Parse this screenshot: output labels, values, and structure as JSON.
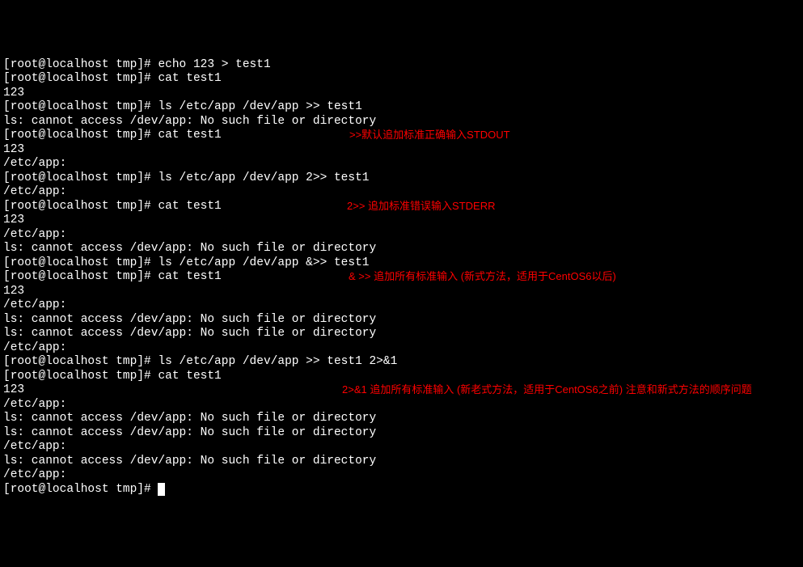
{
  "prompt": "[root@localhost tmp]#",
  "lines": [
    {
      "type": "cmd",
      "text": "echo 123 > test1"
    },
    {
      "type": "cmd",
      "text": "cat test1"
    },
    {
      "type": "out",
      "text": "123"
    },
    {
      "type": "cmd",
      "text": "ls /etc/app /dev/app >> test1"
    },
    {
      "type": "out",
      "text": "ls: cannot access /dev/app: No such file or directory"
    },
    {
      "type": "cmd",
      "text": "cat test1",
      "anno": ">>默认追加标准正确输入STDOUT",
      "annoLeft": 428
    },
    {
      "type": "out",
      "text": "123"
    },
    {
      "type": "out",
      "text": "/etc/app:"
    },
    {
      "type": "cmd",
      "text": "ls /etc/app /dev/app 2>> test1"
    },
    {
      "type": "out",
      "text": "/etc/app:"
    },
    {
      "type": "cmd",
      "text": "cat test1",
      "anno": "2>> 追加标准错误输入STDERR",
      "annoLeft": 425
    },
    {
      "type": "out",
      "text": "123"
    },
    {
      "type": "out",
      "text": "/etc/app:"
    },
    {
      "type": "out",
      "text": "ls: cannot access /dev/app: No such file or directory"
    },
    {
      "type": "cmd",
      "text": "ls /etc/app /dev/app &>> test1"
    },
    {
      "type": "cmd",
      "text": "cat test1",
      "anno": "& >> 追加所有标准输入 (新式方法，适用于CentOS6以后)",
      "annoLeft": 427
    },
    {
      "type": "out",
      "text": "123"
    },
    {
      "type": "out",
      "text": "/etc/app:"
    },
    {
      "type": "out",
      "text": "ls: cannot access /dev/app: No such file or directory"
    },
    {
      "type": "out",
      "text": "ls: cannot access /dev/app: No such file or directory"
    },
    {
      "type": "out",
      "text": "/etc/app:"
    },
    {
      "type": "cmd",
      "text": "ls /etc/app /dev/app >> test1 2>&1"
    },
    {
      "type": "cmd",
      "text": "cat test1"
    },
    {
      "type": "out",
      "text": "123",
      "anno": "2>&1 追加所有标准输入 (新老式方法，适用于CentOS6之前) 注意和新式方法的顺序问题",
      "annoLeft": 419
    },
    {
      "type": "out",
      "text": "/etc/app:"
    },
    {
      "type": "out",
      "text": "ls: cannot access /dev/app: No such file or directory"
    },
    {
      "type": "out",
      "text": "ls: cannot access /dev/app: No such file or directory"
    },
    {
      "type": "out",
      "text": "/etc/app:"
    },
    {
      "type": "out",
      "text": "ls: cannot access /dev/app: No such file or directory"
    },
    {
      "type": "out",
      "text": "/etc/app:"
    },
    {
      "type": "cmd",
      "text": "",
      "cursor": true
    }
  ]
}
